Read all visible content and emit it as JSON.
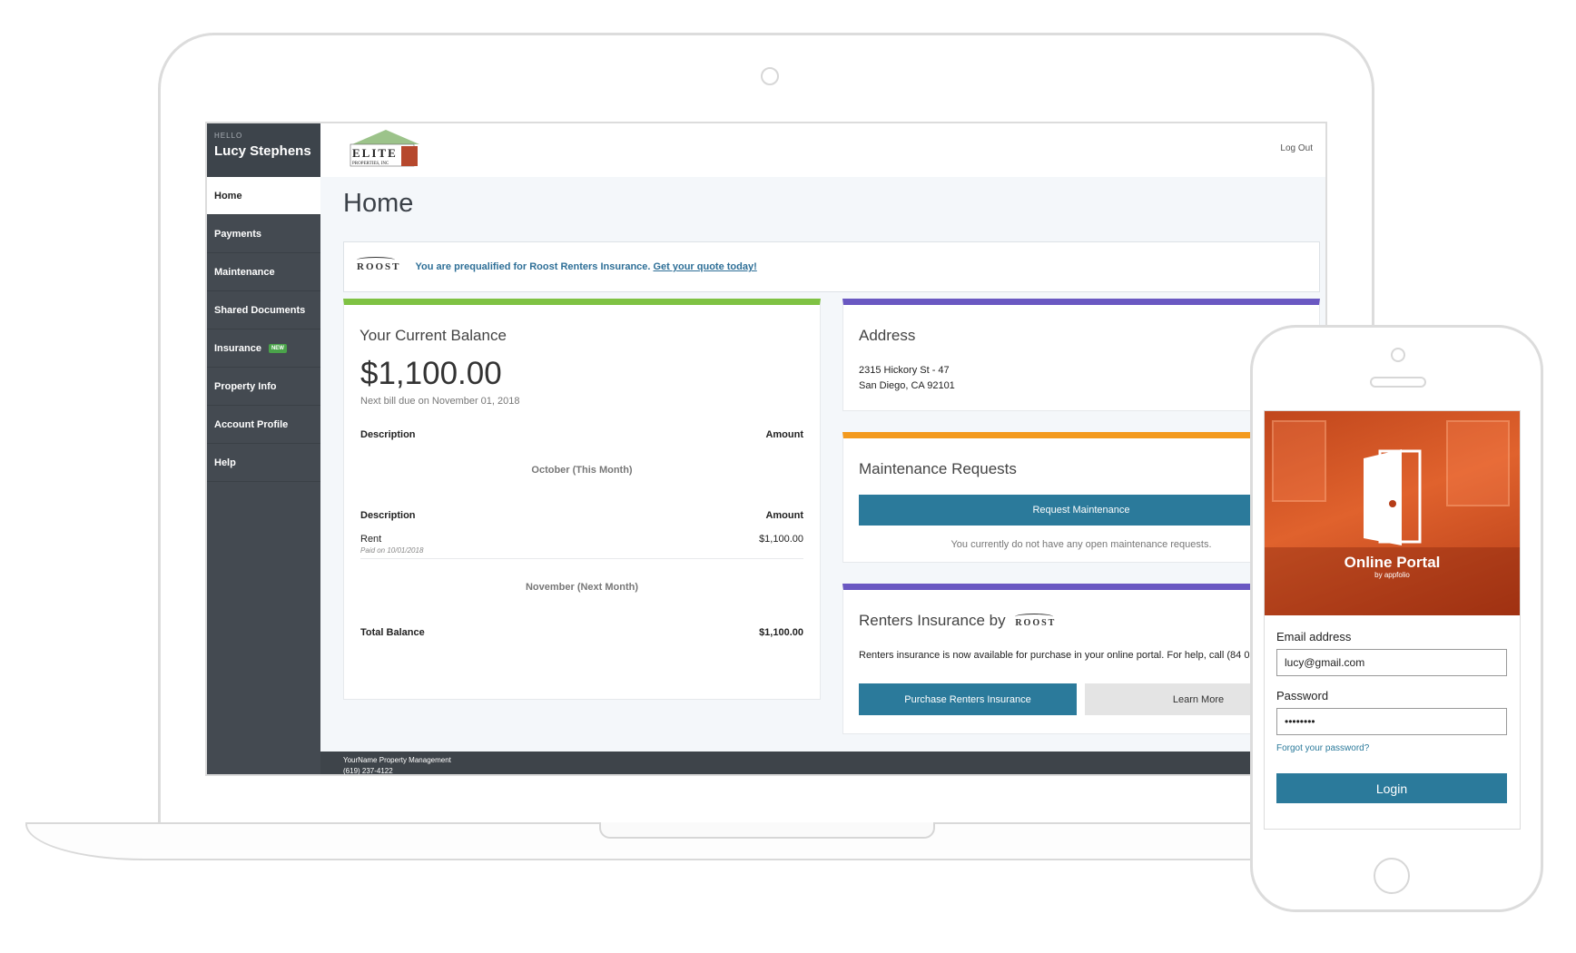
{
  "sidebar": {
    "greeting": "HELLO",
    "user_name": "Lucy Stephens",
    "items": [
      {
        "label": "Home"
      },
      {
        "label": "Payments"
      },
      {
        "label": "Maintenance"
      },
      {
        "label": "Shared Documents"
      },
      {
        "label": "Insurance",
        "badge": "NEW"
      },
      {
        "label": "Property Info"
      },
      {
        "label": "Account Profile"
      },
      {
        "label": "Help"
      }
    ]
  },
  "header": {
    "logo_text": "ELITE",
    "logo_subtext": "PROPERTIES, INC",
    "logout_label": "Log Out"
  },
  "page_title": "Home",
  "promo": {
    "logo": "ROOST",
    "text": "You are prequalified for Roost Renters Insurance.",
    "link": "Get your quote today!"
  },
  "balance": {
    "title": "Your Current Balance",
    "amount": "$1,100.00",
    "due_text": "Next bill due on November 01, 2018",
    "col_description": "Description",
    "col_amount": "Amount",
    "month_current": "October (This Month)",
    "line_item": "Rent",
    "line_item_sub": "Paid on 10/01/2018",
    "line_amount": "$1,100.00",
    "month_next": "November (Next Month)",
    "total_label": "Total Balance",
    "total_amount": "$1,100.00"
  },
  "address": {
    "title": "Address",
    "line1": "2315 Hickory St - 47",
    "line2": "San Diego, CA 92101"
  },
  "maintenance": {
    "title": "Maintenance Requests",
    "button": "Request Maintenance",
    "empty_text": "You currently do not have any open maintenance requests."
  },
  "renters": {
    "title": "Renters Insurance by",
    "logo": "ROOST",
    "text": "Renters insurance is now available for purchase in your online portal. For help, call (84 0877.",
    "purchase_button": "Purchase Renters Insurance",
    "learn_button": "Learn More"
  },
  "footer": {
    "company": "YourName Property Management",
    "phone": "(619) 237-4122"
  },
  "phone": {
    "hero_title": "Online Portal",
    "hero_by": "by appfolio",
    "email_label": "Email address",
    "email_value": "lucy@gmail.com",
    "password_label": "Password",
    "password_value": "••••••••",
    "forgot": "Forgot your password?",
    "login": "Login"
  },
  "colors": {
    "sidebar": "#444a51",
    "accent_blue": "#2b7a9b",
    "green_bar": "#7fc243",
    "purple_bar": "#6a58c2",
    "orange_bar": "#f39a1e",
    "hero_orange": "#e0622d"
  }
}
